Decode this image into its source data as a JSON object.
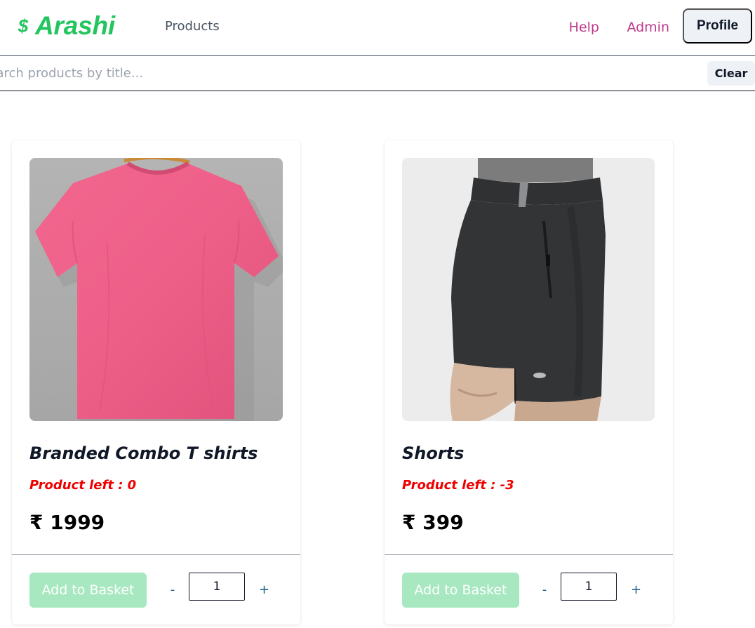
{
  "header": {
    "brand_name": "Arashi",
    "brand_icon": "currency-icon",
    "nav": {
      "products": "Products",
      "help": "Help",
      "admin": "Admin",
      "profile": "Profile"
    }
  },
  "search": {
    "placeholder": "Search products by title...",
    "value": "",
    "clear_label": "Clear"
  },
  "products": [
    {
      "title": "Branded Combo T shirts",
      "stock_label": "Product left : 0",
      "price": "₹ 1999",
      "add_label": "Add to Basket",
      "quantity": "1",
      "minus": "-",
      "plus": "+",
      "image": "pink-tshirt-image"
    },
    {
      "title": "Shorts",
      "stock_label": "Product left : -3",
      "price": "₹ 399",
      "add_label": "Add to Basket",
      "quantity": "1",
      "minus": "-",
      "plus": "+",
      "image": "black-shorts-image"
    }
  ],
  "colors": {
    "brand": "#22c55e",
    "nav_link": "#be3a8c",
    "stock": "#ef0000",
    "add_button_disabled": "#a7e8c0",
    "stepper": "#1d5f8a"
  }
}
